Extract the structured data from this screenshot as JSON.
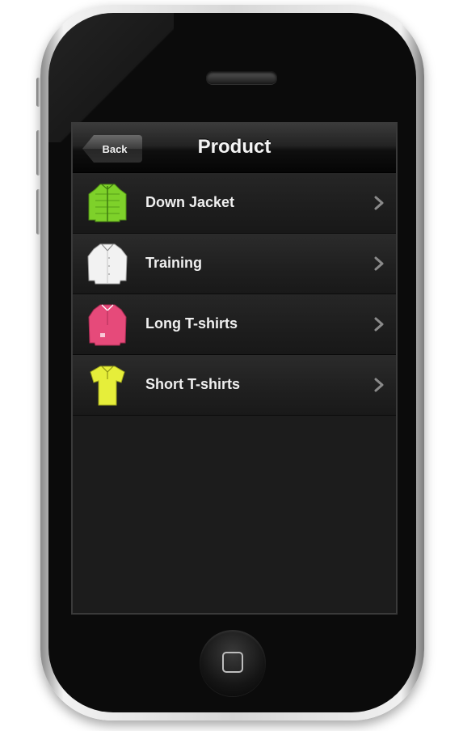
{
  "navbar": {
    "back_label": "Back",
    "title": "Product"
  },
  "products": [
    {
      "label": "Down Jacket",
      "icon": "green-down-jacket-icon",
      "color": "#7ed12a"
    },
    {
      "label": "Training",
      "icon": "white-shirt-icon",
      "color": "#f2f2f2"
    },
    {
      "label": "Long T-shirts",
      "icon": "pink-long-sleeve-shirt-icon",
      "color": "#e64a7a"
    },
    {
      "label": "Short T-shirts",
      "icon": "yellow-polo-shirt-icon",
      "color": "#e6ee3a"
    }
  ],
  "colors": {
    "screen_bg": "#1c1c1c",
    "text": "#efefef",
    "chevron": "#8a8a8a"
  }
}
